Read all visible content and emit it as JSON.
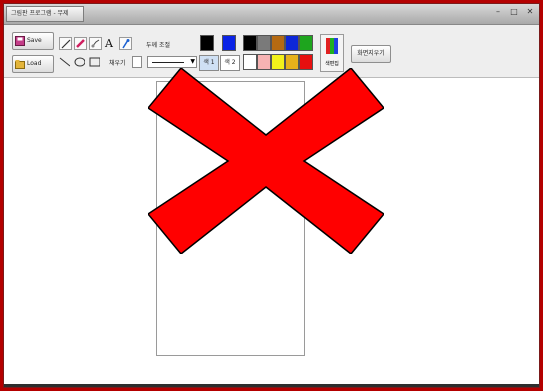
{
  "window": {
    "title": "그림판 프로그램 - 무제",
    "controls": [
      "–",
      "□",
      "✕"
    ]
  },
  "toolbar": {
    "save_label": "Save",
    "load_label": "Load",
    "size_label": "두께 조절",
    "shape_label": "채우기",
    "line_width": "1",
    "toggle_a": "색 1",
    "toggle_b": "색 2",
    "edit_colors_label": "색편집",
    "clear_label": "화면지우기",
    "colors_row1": [
      "#000000",
      "#0a23e6",
      "#000000",
      "#7a7a7a",
      "#b56a12",
      "#0d27d8",
      "#1ea51e"
    ],
    "colors_row2": [
      "#ffffff",
      "#f7b3b3",
      "#f2f21a",
      "#e6b21a",
      "#e60f0f"
    ]
  },
  "icons": {
    "save": "save-icon",
    "load": "load-icon",
    "pencil": "pencil-icon",
    "eraser": "eraser-icon",
    "brush": "brush-icon",
    "text": "text-icon",
    "fill": "fill-icon",
    "line": "line-icon",
    "ellipse": "ellipse-icon",
    "rectangle": "rectangle-icon",
    "palette": "palette-icon"
  },
  "overlay": {
    "symbol": "error-x-icon",
    "color": "#ff0000"
  }
}
